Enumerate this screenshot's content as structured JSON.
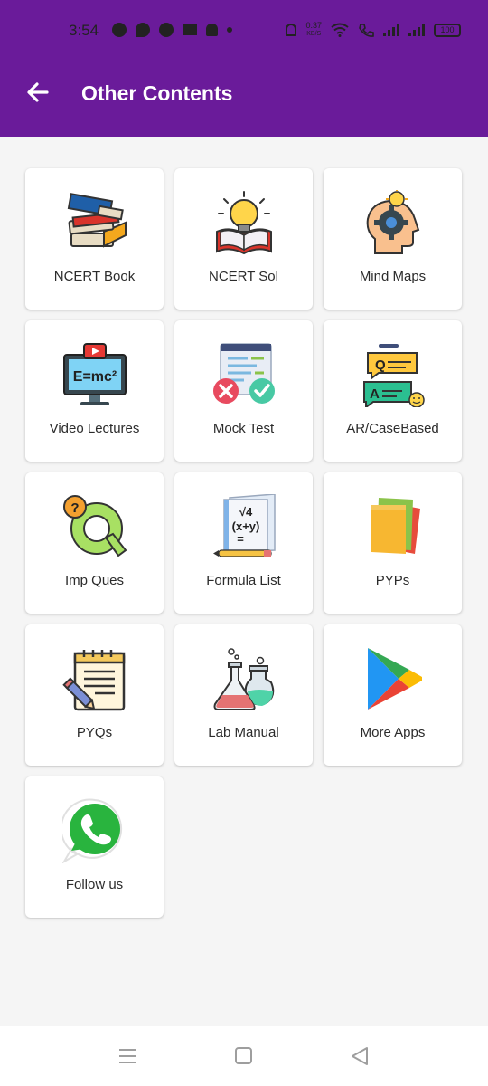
{
  "status_bar": {
    "time": "3:54",
    "net_speed_value": "0.37",
    "net_speed_unit": "KB/S",
    "battery": "100"
  },
  "app_bar": {
    "title": "Other Contents",
    "back_icon": "arrow-left-icon"
  },
  "items": [
    {
      "label": "NCERT Book",
      "icon": "books-icon"
    },
    {
      "label": "NCERT Sol",
      "icon": "bulb-book-icon"
    },
    {
      "label": "Mind Maps",
      "icon": "head-gear-bulb-icon"
    },
    {
      "label": "Video Lectures",
      "icon": "monitor-emc2-icon"
    },
    {
      "label": "Mock Test",
      "icon": "document-check-cross-icon"
    },
    {
      "label": "AR/CaseBased",
      "icon": "qa-chat-icon"
    },
    {
      "label": "Imp Ques",
      "icon": "question-q-icon"
    },
    {
      "label": "Formula List",
      "icon": "formula-notebook-icon"
    },
    {
      "label": "PYPs",
      "icon": "papers-stack-icon"
    },
    {
      "label": "PYQs",
      "icon": "notepad-pencil-icon"
    },
    {
      "label": "Lab Manual",
      "icon": "lab-flasks-icon"
    },
    {
      "label": "More Apps",
      "icon": "play-store-icon"
    },
    {
      "label": "Follow us",
      "icon": "whatsapp-icon"
    }
  ],
  "nav": {
    "menu_icon": "recent-apps-icon",
    "home_icon": "home-square-icon",
    "back_icon": "back-triangle-icon"
  }
}
